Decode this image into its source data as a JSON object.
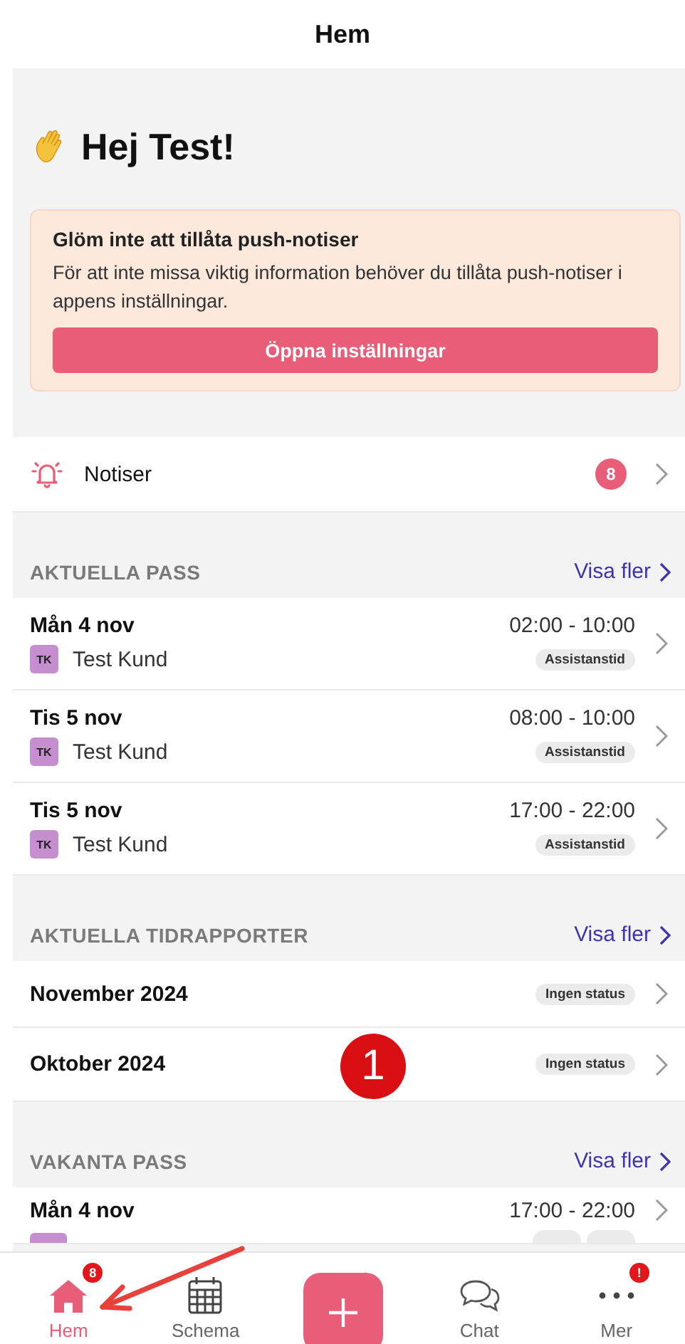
{
  "header": {
    "title": "Hem"
  },
  "greeting": {
    "text": "Hej Test!"
  },
  "notice": {
    "title": "Glöm inte att tillåta push-notiser",
    "body": "För att inte missa viktig information behöver du tillåta push-notiser i appens inställningar.",
    "button": "Öppna inställningar"
  },
  "notifications": {
    "label": "Notiser",
    "badge": "8"
  },
  "sections": [
    {
      "kind": "shifts",
      "title": "AKTUELLA PASS",
      "link": "Visa fler",
      "items": [
        {
          "date": "Mån 4 nov",
          "time": "02:00 - 10:00",
          "initials": "TK",
          "customer": "Test Kund",
          "tag": "Assistanstid"
        },
        {
          "date": "Tis 5 nov",
          "time": "08:00 - 10:00",
          "initials": "TK",
          "customer": "Test Kund",
          "tag": "Assistanstid"
        },
        {
          "date": "Tis 5 nov",
          "time": "17:00 - 22:00",
          "initials": "TK",
          "customer": "Test Kund",
          "tag": "Assistanstid"
        }
      ]
    },
    {
      "kind": "reports",
      "title": "AKTUELLA TIDRAPPORTER",
      "link": "Visa fler",
      "items": [
        {
          "label": "November 2024",
          "status": "Ingen status"
        },
        {
          "label": "Oktober 2024",
          "status": "Ingen status"
        }
      ]
    },
    {
      "kind": "shifts",
      "title": "VAKANTA PASS",
      "link": "Visa fler",
      "items": [
        {
          "date": "Mån 4 nov",
          "time": "17:00 - 22:00"
        }
      ]
    }
  ],
  "step_marker": "1",
  "tabs": [
    {
      "kind": "home",
      "label": "Hem",
      "selected": true,
      "badge": "8"
    },
    {
      "kind": "calendar",
      "label": "Schema",
      "selected": false
    },
    {
      "kind": "add"
    },
    {
      "kind": "chat",
      "label": "Chat",
      "selected": false
    },
    {
      "kind": "more",
      "label": "Mer",
      "selected": false,
      "badge": "!"
    }
  ]
}
